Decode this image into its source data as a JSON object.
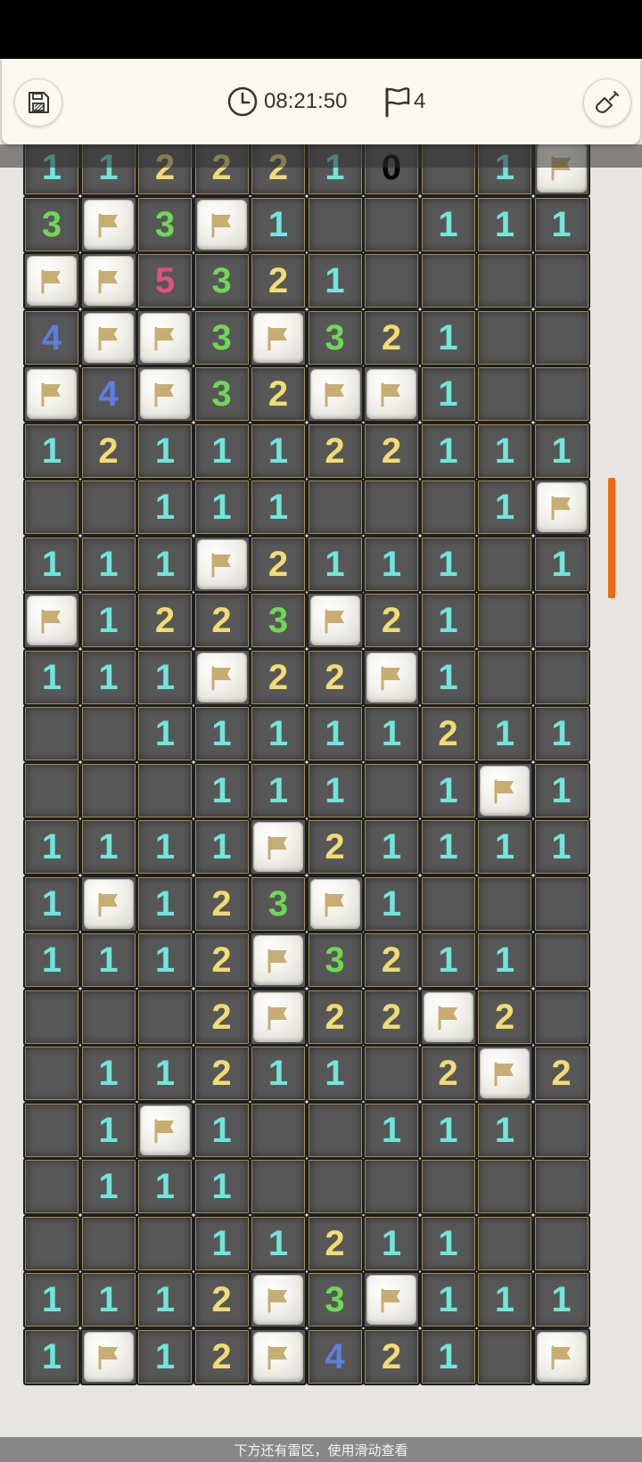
{
  "header": {
    "timer": "08:21:50",
    "flag_count": "4"
  },
  "icons": {
    "save": "save-icon",
    "timer": "clock-icon",
    "flag": "flag-icon",
    "shovel": "shovel-icon"
  },
  "colors": {
    "n1": "#6fe6dc",
    "n2": "#f0dc73",
    "n3": "#6fd856",
    "n4": "#5a7fe0",
    "n5": "#e4507d",
    "flag_tile": "#f2f1ec",
    "flag_glyph": "#c8ad72",
    "scroll_indicator": "#f26a10"
  },
  "board": {
    "rows": [
      "1122210.1F2",
      "3F3F1..111",
      "FF5321....",
      "4FF3F321..",
      "F4F32FF1..",
      "1211122111",
      "..111...1F",
      "111F2111.11",
      "F1223F21..",
      "111F22F1..",
      "..11111211",
      "...111.1F1",
      "1111F21111",
      "1F123F1...",
      "1112F3211.",
      "...2F22F2.",
      ".11211.2F2.",
      ".1F1..111.",
      ".111......",
      "...11211..",
      "1112F3F111",
      "1F12F421.F"
    ]
  },
  "footer": {
    "hint": "下方还有雷区，使用滑动查看"
  }
}
